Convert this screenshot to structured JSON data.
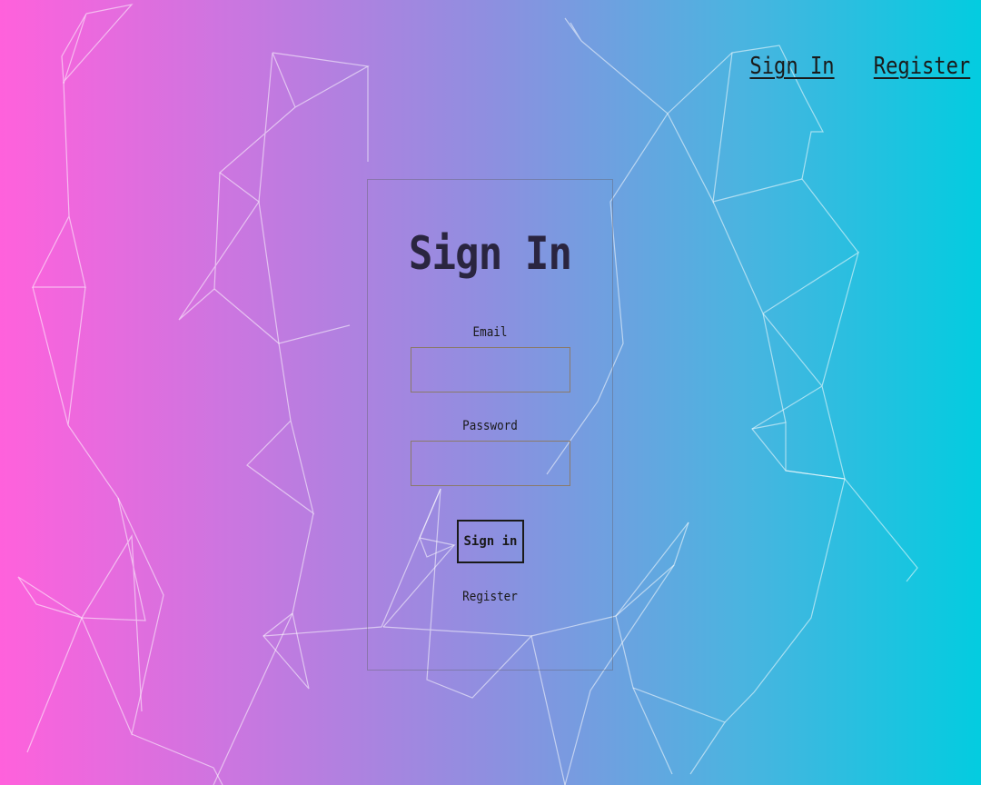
{
  "nav": {
    "sign_in": "Sign In",
    "register": "Register"
  },
  "form": {
    "title": "Sign In",
    "email_label": "Email",
    "email_value": "",
    "password_label": "Password",
    "password_value": "",
    "submit_label": "Sign in",
    "register_link": "Register"
  },
  "colors": {
    "gradient_left": "#ff61dc",
    "gradient_right": "#03cce0",
    "text": "#1a1a1a",
    "input_border": "#8a7a6a"
  }
}
